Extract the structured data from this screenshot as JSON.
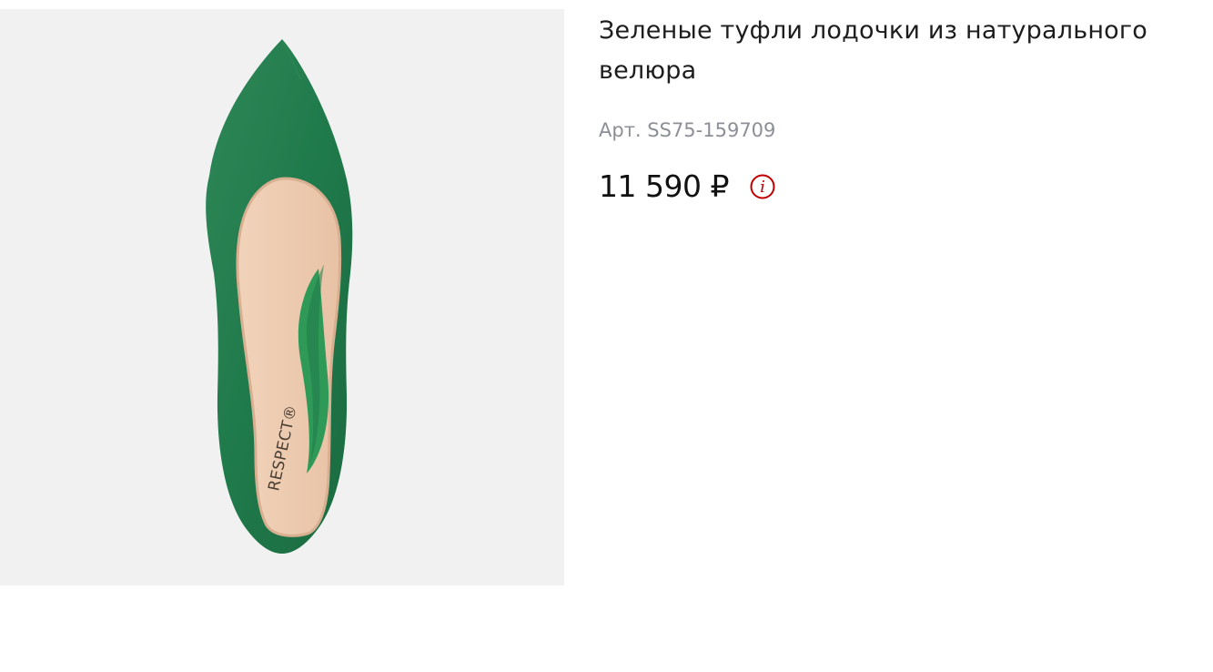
{
  "product": {
    "title": "Зеленые туфли лодочки из натурального велюра",
    "sku": "Арт. SS75-159709",
    "price": "11 590 ₽",
    "image_brand_text": "RESPECT®"
  },
  "colors": {
    "shoe_green": "#1f7a4b",
    "lining": "#efcfb4",
    "info_icon": "#c00000"
  },
  "icons": {
    "info": "info-circle-icon"
  }
}
